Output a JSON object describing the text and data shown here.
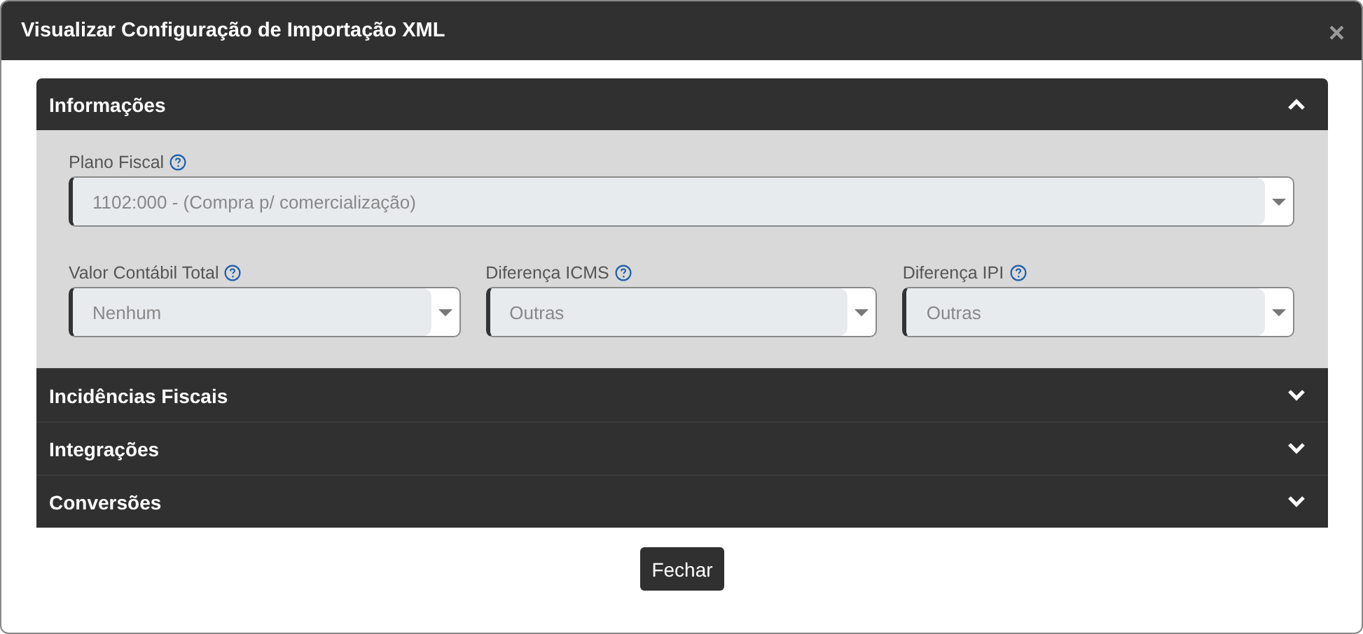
{
  "window": {
    "title": "Visualizar Configuração de Importação XML",
    "close": "×"
  },
  "sections": [
    {
      "title": "Informações",
      "expanded": true,
      "rows": [
        [
          {
            "label": "Plano Fiscal",
            "value": "1102:000 - (Compra p/ comercialização)"
          }
        ],
        [
          {
            "label": "Valor Contábil Total",
            "value": "Nenhum"
          },
          {
            "label": "Diferença ICMS",
            "value": "Outras"
          },
          {
            "label": "Diferença IPI",
            "value": "Outras"
          }
        ]
      ]
    },
    {
      "title": "Incidências Fiscais",
      "expanded": false
    },
    {
      "title": "Integrações",
      "expanded": false
    },
    {
      "title": "Conversões",
      "expanded": false
    }
  ],
  "buttons": [
    "Fechar"
  ]
}
